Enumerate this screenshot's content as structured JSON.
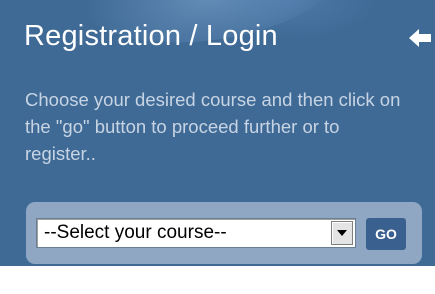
{
  "panel": {
    "title": "Registration / Login",
    "back_icon": "back-arrow-icon",
    "description": "Choose your desired course and then click on the \"go\" button to proceed further or to register..",
    "colors": {
      "background": "#3f6a96",
      "form_background": "#8fa7c3",
      "go_button": "#3a6090"
    }
  },
  "course_select": {
    "selected": "--Select your course--"
  },
  "go_button": {
    "label": "GO"
  }
}
